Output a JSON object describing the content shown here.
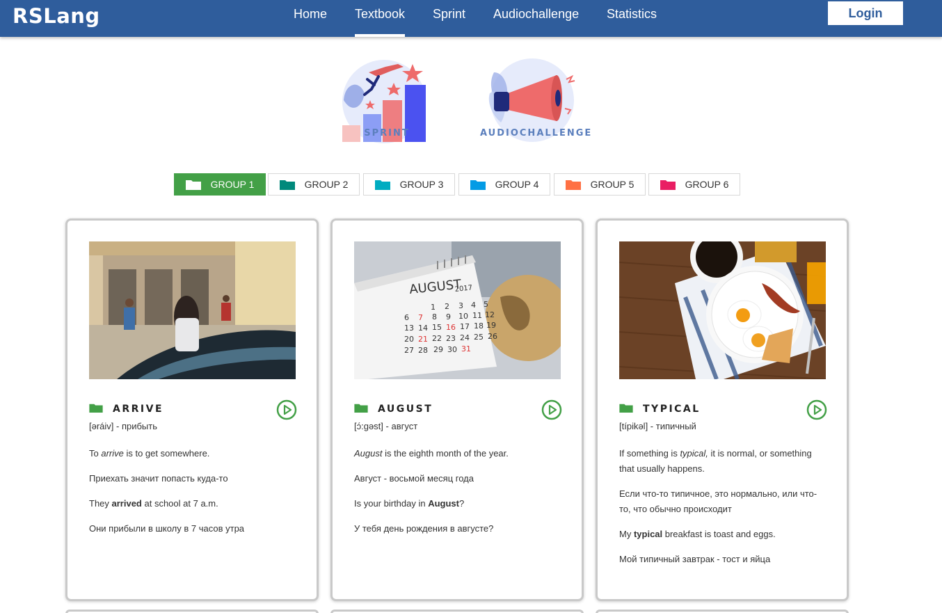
{
  "header": {
    "logo": "RSLang",
    "nav": [
      {
        "label": "Home",
        "active": false
      },
      {
        "label": "Textbook",
        "active": true
      },
      {
        "label": "Sprint",
        "active": false
      },
      {
        "label": "Audiochallenge",
        "active": false
      },
      {
        "label": "Statistics",
        "active": false
      }
    ],
    "login_label": "Login",
    "colors": {
      "bar": "#2f5d9c",
      "text": "#ffffff"
    }
  },
  "games": [
    {
      "label": "SPRINT",
      "icon": "sprint-illustration"
    },
    {
      "label": "AUDIOCHALLENGE",
      "icon": "megaphone-illustration"
    }
  ],
  "groups": [
    {
      "label": "GROUP 1",
      "color": "#43a047",
      "active": true
    },
    {
      "label": "GROUP 2",
      "color": "#00897b",
      "active": false
    },
    {
      "label": "GROUP 3",
      "color": "#00acc1",
      "active": false
    },
    {
      "label": "GROUP 4",
      "color": "#039be5",
      "active": false
    },
    {
      "label": "GROUP 5",
      "color": "#ff7043",
      "active": false
    },
    {
      "label": "GROUP 6",
      "color": "#e91e63",
      "active": false
    }
  ],
  "cards": [
    {
      "word": "ARRIVE",
      "transcription": "[əráiv] - прибыть",
      "meaning_pre": "To ",
      "meaning_em": "arrive",
      "meaning_post": " is to get somewhere.",
      "meaning_translate": "Приехать значит попасть куда-то",
      "example_pre": "They ",
      "example_strong": "arrived",
      "example_post": " at school at 7 a.m.",
      "example_translate": "Они прибыли в школу в 7 часов утра",
      "image": "school-entrance-photo"
    },
    {
      "word": "AUGUST",
      "transcription": "[ɔ́:gəst] - август",
      "meaning_pre": "",
      "meaning_em": "August",
      "meaning_post": " is the eighth month of the year.",
      "meaning_translate": "Август - восьмой месяц года",
      "example_pre": "Is your birthday in ",
      "example_strong": "August",
      "example_post": "?",
      "example_translate": "У тебя день рождения в августе?",
      "image": "calendar-photo",
      "calendar_month": "AUGUST",
      "calendar_year": "2017"
    },
    {
      "word": "TYPICAL",
      "transcription": "[típikəl] - типичный",
      "meaning_pre": "If something is ",
      "meaning_em": "typical,",
      "meaning_post": " it is normal, or something that usually happens.",
      "meaning_translate": "Если что-то типичное, это нормально, или что-то, что обычно происходит",
      "example_pre": "My ",
      "example_strong": "typical",
      "example_post": " breakfast is toast and eggs.",
      "example_translate": "Мой типичный завтрак - тост и яйца",
      "image": "breakfast-photo"
    }
  ],
  "accent_color": "#43a047"
}
